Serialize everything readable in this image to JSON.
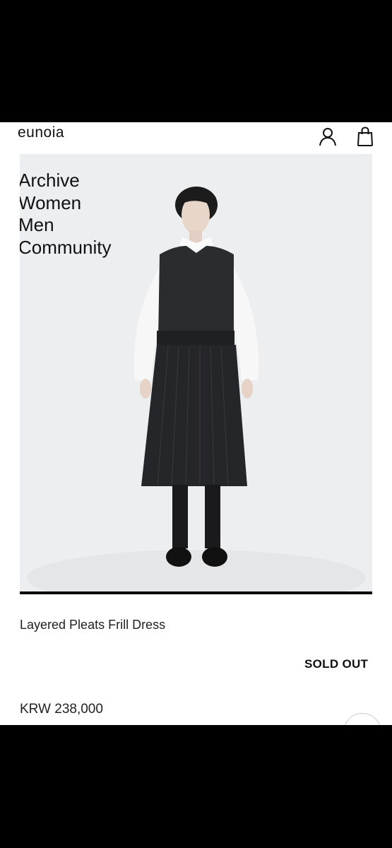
{
  "header": {
    "brand": "eunoia",
    "account_icon": "user-icon",
    "cart_icon": "shopping-bag-icon"
  },
  "nav": {
    "items": [
      {
        "label": "Archive"
      },
      {
        "label": "Women"
      },
      {
        "label": "Men"
      },
      {
        "label": "Community"
      }
    ]
  },
  "product": {
    "name": "Layered Pleats Frill Dress",
    "status": "SOLD OUT",
    "price": "KRW 238,000"
  }
}
